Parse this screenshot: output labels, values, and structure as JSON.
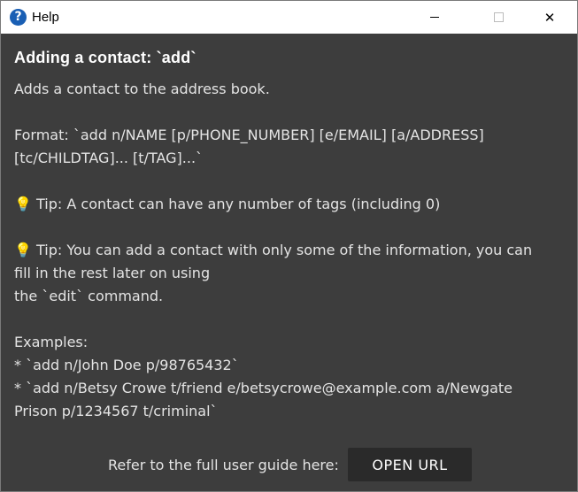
{
  "window": {
    "title": "Help",
    "app_icon": "question-mark-icon",
    "icon_glyph": "?",
    "close_glyph": "✕"
  },
  "help": {
    "heading": "Adding a contact: `add`",
    "body": "Adds a contact to the address book.\n\nFormat: `add n/NAME [p/PHONE_NUMBER] [e/EMAIL] [a/ADDRESS]\n[tc/CHILDTAG]... [t/TAG]...`\n\n💡 Tip: A contact can have any number of tags (including 0)\n\n💡 Tip: You can add a contact with only some of the information, you can\nfill in the rest later on using\nthe `edit` command.\n\nExamples:\n* `add n/John Doe p/98765432`\n* `add n/Betsy Crowe t/friend e/betsycrowe@example.com a/Newgate\nPrison p/1234567 t/criminal`"
  },
  "footer": {
    "label": "Refer to the full user guide here:",
    "button_label": "OPEN URL"
  },
  "colors": {
    "background": "#3d3d3d",
    "titlebar": "#ffffff",
    "button": "#2a2a2a",
    "text": "#ffffff"
  }
}
